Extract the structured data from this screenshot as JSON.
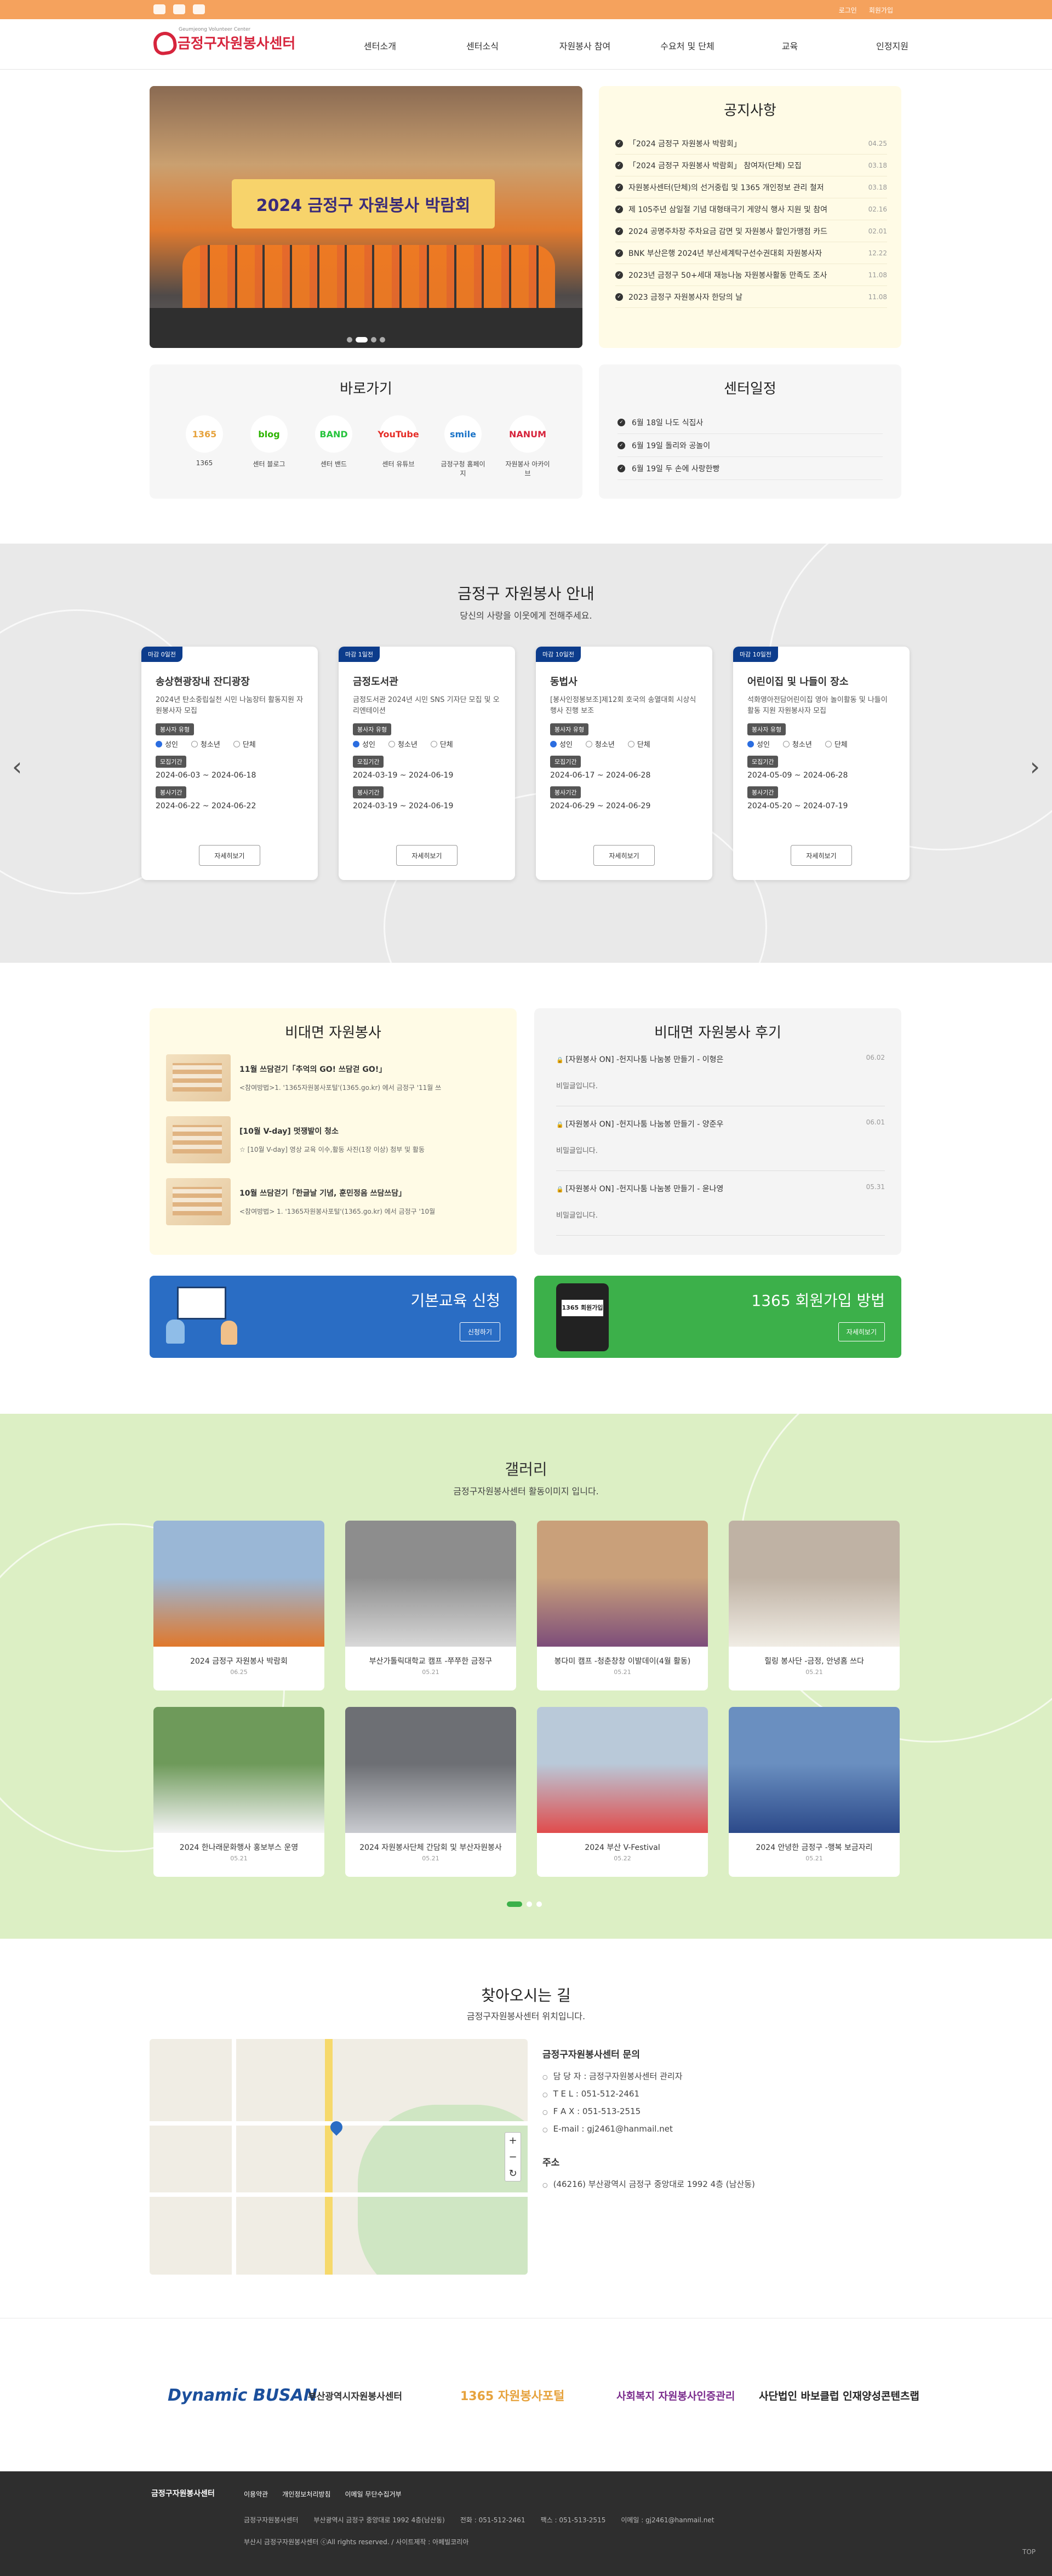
{
  "topbar": {
    "login": "로그인",
    "join": "회원가입"
  },
  "header": {
    "logo_sub": "Geumjeong Volunteer Center",
    "logo_name": "금정구자원봉사센터",
    "menu": [
      "센터소개",
      "센터소식",
      "자원봉사 참여",
      "수요처 및 단체",
      "교육",
      "인정지원"
    ]
  },
  "hero": {
    "banner": "2024 금정구 자원봉사 박람회"
  },
  "notice": {
    "title": "공지사항",
    "items": [
      {
        "t": "「2024 금정구 자원봉사 박람회」",
        "d": "04.25"
      },
      {
        "t": "「2024 금정구 자원봉사 박람회」 참여자(단체) 모집",
        "d": "03.18"
      },
      {
        "t": "자원봉사센터(단체)의 선거중립 및 1365 개인정보 관리 철저",
        "d": "03.18"
      },
      {
        "t": "제 105주년 삼일절 기념 대형태극기 게양식 행사 지원 및 참여",
        "d": "02.16"
      },
      {
        "t": "2024 공명주차장 주차요금 감면 및 자원봉사 할인가맹점 카드",
        "d": "02.01"
      },
      {
        "t": "BNK 부산은행 2024년 부산세계탁구선수권대회 자원봉사자",
        "d": "12.22"
      },
      {
        "t": "2023년 금정구 50+세대 재능나눔 자원봉사활동 만족도 조사",
        "d": "11.08"
      },
      {
        "t": "2023 금정구 자원봉사자 한당의 날",
        "d": "11.08"
      }
    ]
  },
  "quick": {
    "title": "바로가기",
    "items": [
      {
        "icon": "1365",
        "label": "1365",
        "color": "#e6a23c"
      },
      {
        "icon": "blog",
        "label": "센터 블로그",
        "color": "#2db400"
      },
      {
        "icon": "BAND",
        "label": "센터 밴드",
        "color": "#26c43d"
      },
      {
        "icon": "YouTube",
        "label": "센터 유튜브",
        "color": "#e52d27"
      },
      {
        "icon": "smile",
        "label": "금정구청 홈페이지",
        "color": "#1a73c7"
      },
      {
        "icon": "NANUM",
        "label": "자원봉사 아카이브",
        "color": "#d6243c"
      }
    ]
  },
  "schedule": {
    "title": "센터일정",
    "items": [
      "6월 18일 나도 식집사",
      "6월 19일 돌리와 공놀이",
      "6월 19일 두 손에 사랑한빵"
    ]
  },
  "guide": {
    "title": "금정구 자원봉사 안내",
    "subtitle": "당신의 사랑을 이웃에게 전해주세요.",
    "type_label": "봉사자 유형",
    "recruit_label": "모집기간",
    "period_label": "봉사기간",
    "types": [
      "성인",
      "청소년",
      "단체"
    ],
    "more": "자세히보기",
    "cards": [
      {
        "badge": "마감 0일전",
        "title": "송상현광장내 잔디광장",
        "desc": "2024년 탄소중립실천 시민 나눔장터 활동지원 자원봉사자 모집",
        "recruit": "2024-06-03 ~ 2024-06-18",
        "period": "2024-06-22 ~ 2024-06-22"
      },
      {
        "badge": "마감 1일전",
        "title": "금정도서관",
        "desc": "금정도서관 2024년 시민 SNS 기자단 모집 및 오리엔테이션",
        "recruit": "2024-03-19 ~ 2024-06-19",
        "period": "2024-03-19 ~ 2024-06-19"
      },
      {
        "badge": "마감 10일전",
        "title": "동법사",
        "desc": "[봉사인정봉보조]제12회 호국의 송열대회 시상식 행사 진행 보조",
        "recruit": "2024-06-17 ~ 2024-06-28",
        "period": "2024-06-29 ~ 2024-06-29"
      },
      {
        "badge": "마감 10일전",
        "title": "어린이집 및 나들이 장소",
        "desc": "석화영아전담어린이집 영아 놀이활동 및 나들이 활동 지원 자원봉사자 모집",
        "recruit": "2024-05-09 ~ 2024-06-28",
        "period": "2024-05-20 ~ 2024-07-19"
      }
    ]
  },
  "contactless": {
    "title": "비대면 자원봉사",
    "items": [
      {
        "t": "11월 쓰담걷기「추억의 GO! 쓰담걷 GO!」",
        "s": "<참여방법>1. '1365자원봉사포털'(1365.go.kr) 에서 금정구 '11월 쓰"
      },
      {
        "t": "[10월 V-day] 멋쟁발이 청소",
        "s": "☆ [10월 V-day] 영상 교육 이수,활동 사진(1장 이상) 첨부 및 활동"
      },
      {
        "t": "10월 쓰담걷기「한글날 기념, 훈민정음 쓰담쓰담」",
        "s": "<참여방법> 1. '1365자원봉사포털'(1365.go.kr) 에서 금정구 '10월"
      }
    ]
  },
  "review": {
    "title": "비대면 자원봉사 후기",
    "items": [
      {
        "t": "[자원봉사 ON] -헌지나툼 나눔봉 만들기 - 이형은",
        "d": "06.02",
        "b": "비밀글입니다."
      },
      {
        "t": "[자원봉사 ON] -헌지나툼 나눔봉 만들기 - 양준우",
        "d": "06.01",
        "b": "비밀글입니다."
      },
      {
        "t": "[자원봉사 ON] -헌지나툼 나눔봉 만들기 - 윤나영",
        "d": "05.31",
        "b": "비밀글입니다."
      }
    ]
  },
  "banners": [
    {
      "title": "기본교육 신청",
      "btn": "신청하기",
      "color": "#2a6dc4"
    },
    {
      "title": "1365 회원가입 방법",
      "btn": "자세히보기",
      "color": "#3cb04a",
      "badge": "1365 회원가입"
    }
  ],
  "gallery": {
    "title": "갤러리",
    "subtitle": "금정구자원봉사센터 활동이미지 입니다.",
    "items": [
      {
        "cap": "2024 금정구 자원봉사 박람회",
        "d": "06.25",
        "c1": "#9ab7d6",
        "c2": "#e0782c"
      },
      {
        "cap": "부산가톨릭대학교 캠프 -쭈쭈한 금정구",
        "d": "05.21",
        "c1": "#8d8d8d",
        "c2": "#d8d8d8"
      },
      {
        "cap": "봉다미 캠프 -청춘창창 이발데이(4월 활동)",
        "d": "05.21",
        "c1": "#c9a07a",
        "c2": "#7d4d7a"
      },
      {
        "cap": "힐링 봉사단 -금정, 안녕홈 쓰다",
        "d": "05.21",
        "c1": "#bfb2a4",
        "c2": "#f0ece4"
      },
      {
        "cap": "2024 한나래문화행사 홍보부스 운영",
        "d": "05.21",
        "c1": "#6e9a5a",
        "c2": "#f4f4f4"
      },
      {
        "cap": "2024 자원봉사단체 간담회 및 부산자원봉사",
        "d": "05.21",
        "c1": "#6d6f74",
        "c2": "#c9cbd0"
      },
      {
        "cap": "2024 부산 V-Festival",
        "d": "05.22",
        "c1": "#b9c9d9",
        "c2": "#e04c4c"
      },
      {
        "cap": "2024 안녕한 금정구 -행복 보금자리",
        "d": "05.21",
        "c1": "#6a8fc0",
        "c2": "#2c4a8a"
      }
    ]
  },
  "map": {
    "title": "찾아오시는 길",
    "subtitle": "금정구자원봉사센터 위치입니다.",
    "inq_title": "금정구자원봉사센터 문의",
    "inq": [
      "담 당 자 : 금정구자원봉사센터 관리자",
      "T E L : 051-512-2461",
      "F A X : 051-513-2515",
      "E-mail : gj2461@hanmail.net"
    ],
    "addr_title": "주소",
    "addr": "(46216) 부산광역시 금정구 중앙대로 1992 4층 (남산동)"
  },
  "partners": [
    {
      "name": "Dynamic BUSAN",
      "color": "#1b4f9c"
    },
    {
      "name": "부산광역시자원봉사센터",
      "color": "#333"
    },
    {
      "name": "1365 자원봉사포털",
      "color": "#e6a23c"
    },
    {
      "name": "사회복지 자원봉사인증관리",
      "color": "#7a2b8c"
    },
    {
      "name": "사단법인 바보클럽 인재양성콘텐츠랩",
      "color": "#222"
    }
  ],
  "footer": {
    "logo": "금정구자원봉사센터",
    "links": [
      "이용약관",
      "개인정보처리방침",
      "이메일 무단수집거부"
    ],
    "org": "금정구자원봉사센터",
    "address": "부산광역시 금정구 중앙대로 1992 4층(남산동)",
    "tel": "전화 : 051-512-2461",
    "fax": "팩스 : 051-513-2515",
    "email": "이메일 : gj2461@hanmail.net",
    "copy": "부산시 금정구자원봉사센터 ⓒAll rights reserved.  /  사이트제작 : 아페빌코리아",
    "top": "TOP"
  }
}
